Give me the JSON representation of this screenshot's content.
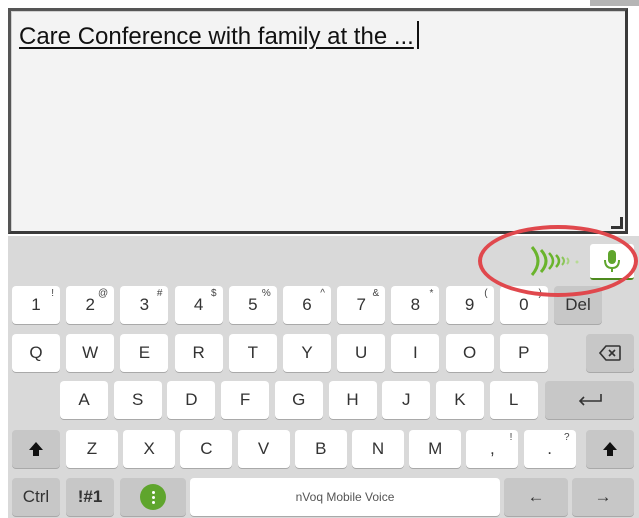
{
  "text_field": {
    "value": "Care Conference with family at the ..."
  },
  "voice": {
    "mic_icon": "microphone-icon",
    "waves_icon": "sound-waves-icon",
    "accent_color": "#6ab42d",
    "highlight_color": "#e0484d"
  },
  "keyboard": {
    "row1": [
      {
        "label": "1",
        "sup": "!"
      },
      {
        "label": "2",
        "sup": "@"
      },
      {
        "label": "3",
        "sup": "#"
      },
      {
        "label": "4",
        "sup": "$"
      },
      {
        "label": "5",
        "sup": "%"
      },
      {
        "label": "6",
        "sup": "^"
      },
      {
        "label": "7",
        "sup": "&"
      },
      {
        "label": "8",
        "sup": "*"
      },
      {
        "label": "9",
        "sup": "("
      },
      {
        "label": "0",
        "sup": ")"
      },
      {
        "label": "Del",
        "sup": ""
      }
    ],
    "row2": [
      "Q",
      "W",
      "E",
      "R",
      "T",
      "Y",
      "U",
      "I",
      "O",
      "P"
    ],
    "row3": [
      "A",
      "S",
      "D",
      "F",
      "G",
      "H",
      "J",
      "K",
      "L"
    ],
    "row4": [
      {
        "label": "Z",
        "sup": ""
      },
      {
        "label": "X",
        "sup": ""
      },
      {
        "label": "C",
        "sup": ""
      },
      {
        "label": "V",
        "sup": ""
      },
      {
        "label": "B",
        "sup": ""
      },
      {
        "label": "N",
        "sup": ""
      },
      {
        "label": "M",
        "sup": ""
      },
      {
        "label": ",",
        "sup": "!"
      },
      {
        "label": ".",
        "sup": "?"
      }
    ],
    "ctrl_label": "Ctrl",
    "symbols_label": "!#1",
    "space_label": "nVoq Mobile Voice",
    "left_arrow": "←",
    "right_arrow": "→",
    "icons": {
      "backspace": "backspace-icon",
      "enter": "enter-icon",
      "shift": "shift-icon",
      "menu": "menu-dots-icon"
    }
  }
}
